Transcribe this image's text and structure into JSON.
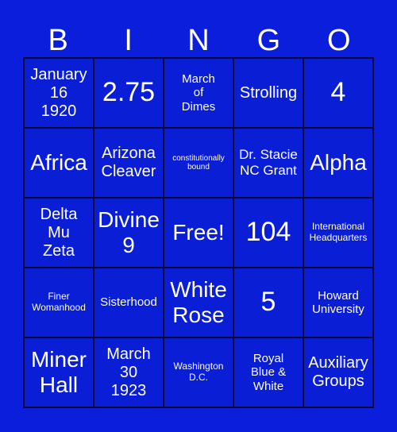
{
  "header": {
    "letters": [
      "B",
      "I",
      "N",
      "G",
      "O"
    ]
  },
  "colors": {
    "background": "#0a1edb",
    "cell": "#0a1ed6",
    "grid_line": "#0a0a3a",
    "text": "#ffffff"
  },
  "cells": [
    {
      "text": "January\n16\n1920",
      "size": "m"
    },
    {
      "text": "2.75",
      "size": "xl"
    },
    {
      "text": "March\nof\nDimes",
      "size": "s"
    },
    {
      "text": "Strolling",
      "size": "m"
    },
    {
      "text": "4",
      "size": "xl"
    },
    {
      "text": "Africa",
      "size": "l"
    },
    {
      "text": "Arizona\nCleaver",
      "size": "m"
    },
    {
      "text": "constitutionally\nbound",
      "size": "xxs"
    },
    {
      "text": "Dr. Stacie\nNC Grant",
      "size": "ms"
    },
    {
      "text": "Alpha",
      "size": "l"
    },
    {
      "text": "Delta\nMu\nZeta",
      "size": "m"
    },
    {
      "text": "Divine\n9",
      "size": "l"
    },
    {
      "text": "Free!",
      "size": "l"
    },
    {
      "text": "104",
      "size": "xl"
    },
    {
      "text": "International\nHeadquarters",
      "size": "xs"
    },
    {
      "text": "Finer\nWomanhood",
      "size": "xs"
    },
    {
      "text": "Sisterhood",
      "size": "s"
    },
    {
      "text": "White\nRose",
      "size": "l"
    },
    {
      "text": "5",
      "size": "xl"
    },
    {
      "text": "Howard\nUniversity",
      "size": "s"
    },
    {
      "text": "Miner\nHall",
      "size": "l"
    },
    {
      "text": "March\n30\n1923",
      "size": "m"
    },
    {
      "text": "Washington\nD.C.",
      "size": "xs"
    },
    {
      "text": "Royal\nBlue &\nWhite",
      "size": "s"
    },
    {
      "text": "Auxiliary\nGroups",
      "size": "m"
    }
  ]
}
